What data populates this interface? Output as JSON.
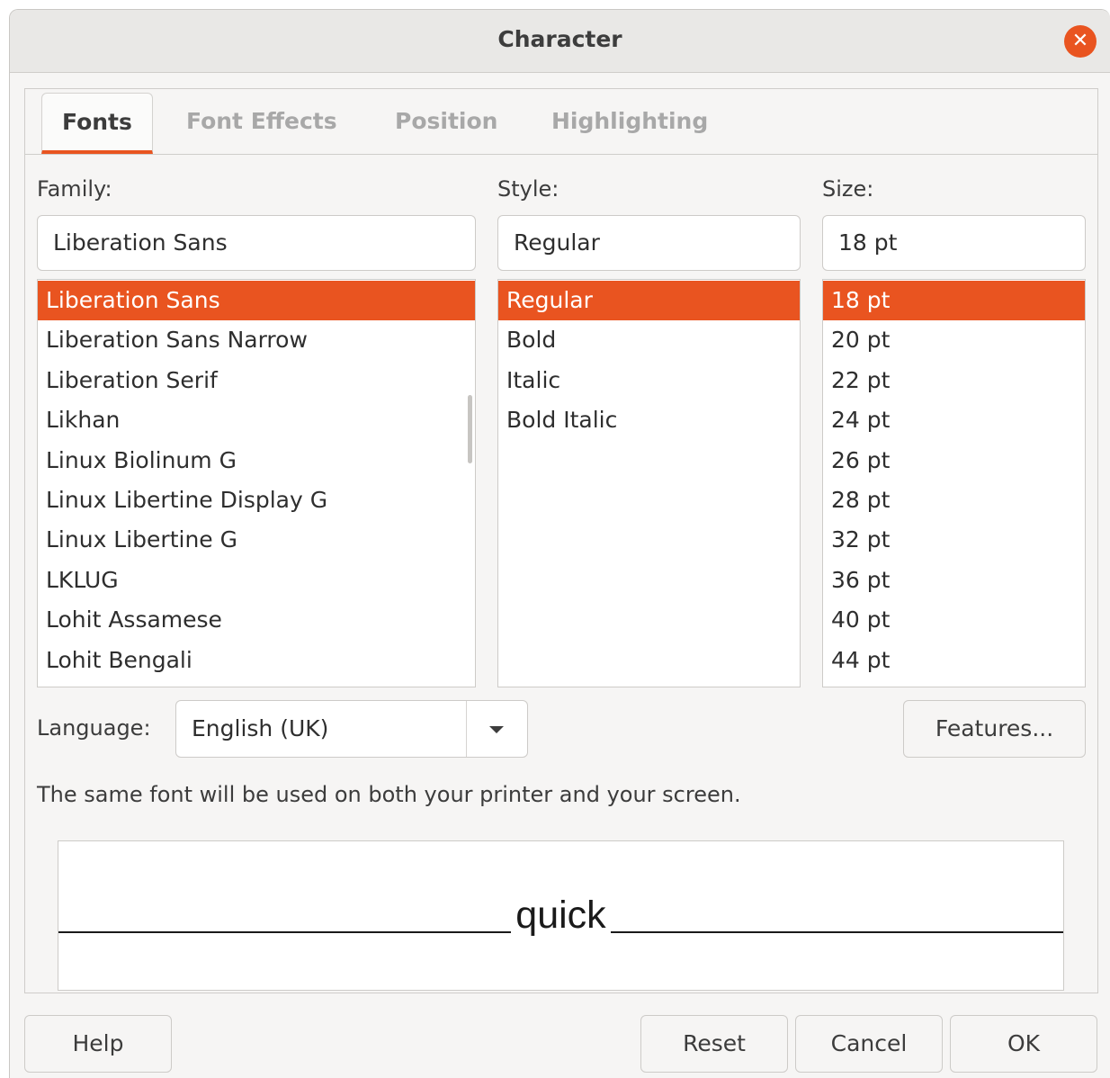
{
  "dialog": {
    "title": "Character"
  },
  "tabs": [
    {
      "label": "Fonts",
      "active": true
    },
    {
      "label": "Font Effects",
      "active": false
    },
    {
      "label": "Position",
      "active": false
    },
    {
      "label": "Highlighting",
      "active": false
    }
  ],
  "family": {
    "label": "Family:",
    "value": "Liberation Sans",
    "items": [
      "Liberation Sans",
      "Liberation Sans Narrow",
      "Liberation Serif",
      "Likhan",
      "Linux Biolinum G",
      "Linux Libertine Display G",
      "Linux Libertine G",
      "LKLUG",
      "Lohit Assamese",
      "Lohit Bengali"
    ],
    "selected_index": 0
  },
  "style": {
    "label": "Style:",
    "value": "Regular",
    "items": [
      "Regular",
      "Bold",
      "Italic",
      "Bold Italic"
    ],
    "selected_index": 0
  },
  "size": {
    "label": "Size:",
    "value": "18 pt",
    "items": [
      "18 pt",
      "20 pt",
      "22 pt",
      "24 pt",
      "26 pt",
      "28 pt",
      "32 pt",
      "36 pt",
      "40 pt",
      "44 pt"
    ],
    "selected_index": 0
  },
  "language": {
    "label": "Language:",
    "value": "English (UK)"
  },
  "features_button": "Features...",
  "info_text": "The same font will be used on both your printer and your screen.",
  "preview": {
    "text": "quick"
  },
  "footer": {
    "help": "Help",
    "reset": "Reset",
    "cancel": "Cancel",
    "ok": "OK"
  },
  "colors": {
    "accent": "#e95420",
    "background": "#f6f5f4"
  },
  "icons": {
    "close": "close-icon",
    "dropdown": "chevron-down-icon"
  }
}
